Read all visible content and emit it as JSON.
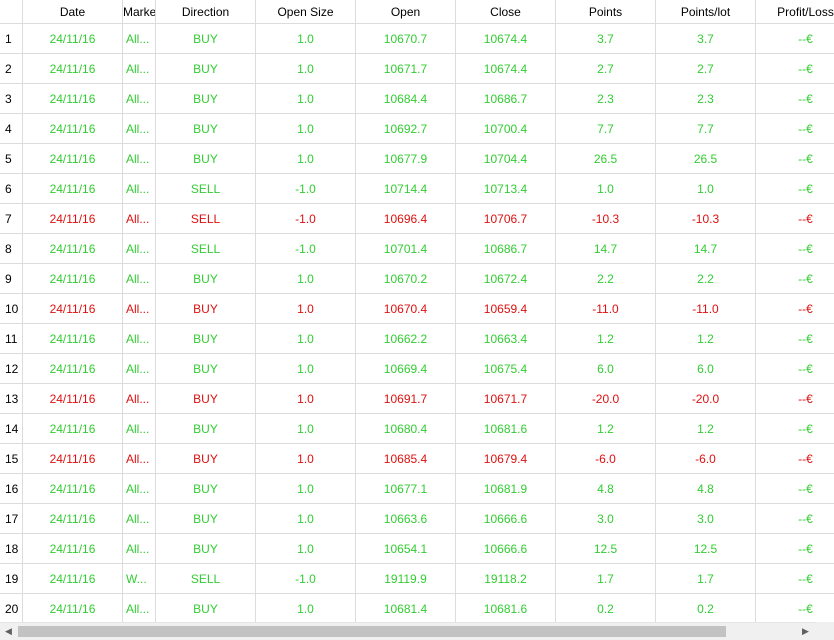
{
  "columns": [
    "",
    "Date",
    "Marke",
    "Direction",
    "Open Size",
    "Open",
    "Close",
    "Points",
    "Points/lot",
    "Profit/Loss"
  ],
  "rows": [
    {
      "n": "1",
      "date": "24/11/16",
      "market": "All...",
      "direction": "BUY",
      "size": "1.0",
      "open": "10670.7",
      "close": "10674.4",
      "points": "3.7",
      "ppl": "3.7",
      "pl": "--€",
      "color": "green"
    },
    {
      "n": "2",
      "date": "24/11/16",
      "market": "All...",
      "direction": "BUY",
      "size": "1.0",
      "open": "10671.7",
      "close": "10674.4",
      "points": "2.7",
      "ppl": "2.7",
      "pl": "--€",
      "color": "green"
    },
    {
      "n": "3",
      "date": "24/11/16",
      "market": "All...",
      "direction": "BUY",
      "size": "1.0",
      "open": "10684.4",
      "close": "10686.7",
      "points": "2.3",
      "ppl": "2.3",
      "pl": "--€",
      "color": "green"
    },
    {
      "n": "4",
      "date": "24/11/16",
      "market": "All...",
      "direction": "BUY",
      "size": "1.0",
      "open": "10692.7",
      "close": "10700.4",
      "points": "7.7",
      "ppl": "7.7",
      "pl": "--€",
      "color": "green"
    },
    {
      "n": "5",
      "date": "24/11/16",
      "market": "All...",
      "direction": "BUY",
      "size": "1.0",
      "open": "10677.9",
      "close": "10704.4",
      "points": "26.5",
      "ppl": "26.5",
      "pl": "--€",
      "color": "green"
    },
    {
      "n": "6",
      "date": "24/11/16",
      "market": "All...",
      "direction": "SELL",
      "size": "-1.0",
      "open": "10714.4",
      "close": "10713.4",
      "points": "1.0",
      "ppl": "1.0",
      "pl": "--€",
      "color": "green"
    },
    {
      "n": "7",
      "date": "24/11/16",
      "market": "All...",
      "direction": "SELL",
      "size": "-1.0",
      "open": "10696.4",
      "close": "10706.7",
      "points": "-10.3",
      "ppl": "-10.3",
      "pl": "--€",
      "color": "red"
    },
    {
      "n": "8",
      "date": "24/11/16",
      "market": "All...",
      "direction": "SELL",
      "size": "-1.0",
      "open": "10701.4",
      "close": "10686.7",
      "points": "14.7",
      "ppl": "14.7",
      "pl": "--€",
      "color": "green"
    },
    {
      "n": "9",
      "date": "24/11/16",
      "market": "All...",
      "direction": "BUY",
      "size": "1.0",
      "open": "10670.2",
      "close": "10672.4",
      "points": "2.2",
      "ppl": "2.2",
      "pl": "--€",
      "color": "green"
    },
    {
      "n": "10",
      "date": "24/11/16",
      "market": "All...",
      "direction": "BUY",
      "size": "1.0",
      "open": "10670.4",
      "close": "10659.4",
      "points": "-11.0",
      "ppl": "-11.0",
      "pl": "--€",
      "color": "red"
    },
    {
      "n": "11",
      "date": "24/11/16",
      "market": "All...",
      "direction": "BUY",
      "size": "1.0",
      "open": "10662.2",
      "close": "10663.4",
      "points": "1.2",
      "ppl": "1.2",
      "pl": "--€",
      "color": "green"
    },
    {
      "n": "12",
      "date": "24/11/16",
      "market": "All...",
      "direction": "BUY",
      "size": "1.0",
      "open": "10669.4",
      "close": "10675.4",
      "points": "6.0",
      "ppl": "6.0",
      "pl": "--€",
      "color": "green"
    },
    {
      "n": "13",
      "date": "24/11/16",
      "market": "All...",
      "direction": "BUY",
      "size": "1.0",
      "open": "10691.7",
      "close": "10671.7",
      "points": "-20.0",
      "ppl": "-20.0",
      "pl": "--€",
      "color": "red"
    },
    {
      "n": "14",
      "date": "24/11/16",
      "market": "All...",
      "direction": "BUY",
      "size": "1.0",
      "open": "10680.4",
      "close": "10681.6",
      "points": "1.2",
      "ppl": "1.2",
      "pl": "--€",
      "color": "green"
    },
    {
      "n": "15",
      "date": "24/11/16",
      "market": "All...",
      "direction": "BUY",
      "size": "1.0",
      "open": "10685.4",
      "close": "10679.4",
      "points": "-6.0",
      "ppl": "-6.0",
      "pl": "--€",
      "color": "red"
    },
    {
      "n": "16",
      "date": "24/11/16",
      "market": "All...",
      "direction": "BUY",
      "size": "1.0",
      "open": "10677.1",
      "close": "10681.9",
      "points": "4.8",
      "ppl": "4.8",
      "pl": "--€",
      "color": "green"
    },
    {
      "n": "17",
      "date": "24/11/16",
      "market": "All...",
      "direction": "BUY",
      "size": "1.0",
      "open": "10663.6",
      "close": "10666.6",
      "points": "3.0",
      "ppl": "3.0",
      "pl": "--€",
      "color": "green"
    },
    {
      "n": "18",
      "date": "24/11/16",
      "market": "All...",
      "direction": "BUY",
      "size": "1.0",
      "open": "10654.1",
      "close": "10666.6",
      "points": "12.5",
      "ppl": "12.5",
      "pl": "--€",
      "color": "green"
    },
    {
      "n": "19",
      "date": "24/11/16",
      "market": "W...",
      "direction": "SELL",
      "size": "-1.0",
      "open": "19119.9",
      "close": "19118.2",
      "points": "1.7",
      "ppl": "1.7",
      "pl": "--€",
      "color": "green"
    },
    {
      "n": "20",
      "date": "24/11/16",
      "market": "All...",
      "direction": "BUY",
      "size": "1.0",
      "open": "10681.4",
      "close": "10681.6",
      "points": "0.2",
      "ppl": "0.2",
      "pl": "--€",
      "color": "green"
    }
  ],
  "colors": {
    "profit": "#33cc33",
    "loss": "#dd1111"
  },
  "scrollbar": {
    "left_icon": "arrow-left-icon",
    "right_icon": "arrow-right-icon"
  }
}
